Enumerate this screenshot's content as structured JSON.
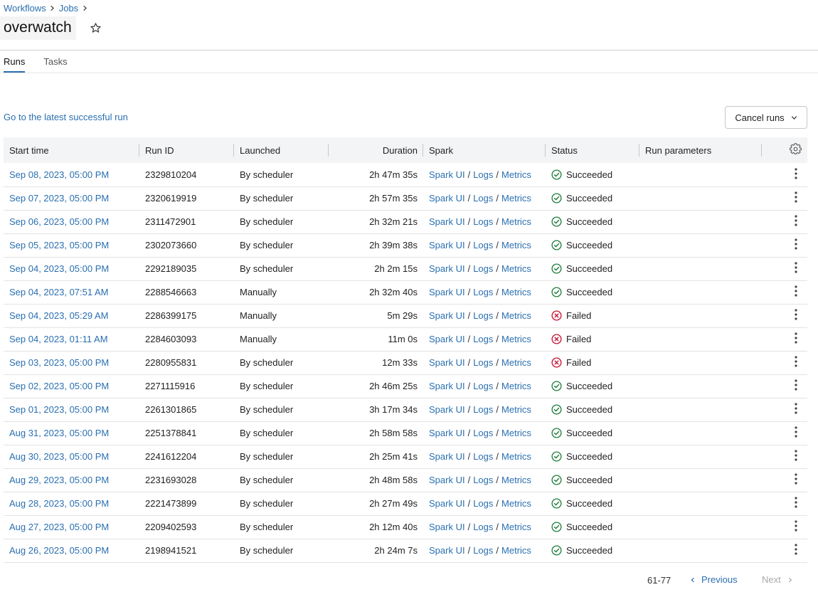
{
  "breadcrumb": [
    "Workflows",
    "Jobs"
  ],
  "job_title": "overwatch",
  "tabs": [
    {
      "label": "Runs",
      "active": true
    },
    {
      "label": "Tasks",
      "active": false
    }
  ],
  "latest_link": "Go to the latest successful run",
  "cancel_runs_label": "Cancel runs",
  "columns": {
    "start_time": "Start time",
    "run_id": "Run ID",
    "launched": "Launched",
    "duration": "Duration",
    "spark": "Spark",
    "status": "Status",
    "run_parameters": "Run parameters"
  },
  "spark_links": {
    "ui": "Spark UI",
    "sep": "/",
    "logs": "Logs",
    "metrics": "Metrics"
  },
  "runs": [
    {
      "start": "Sep 08, 2023, 05:00 PM",
      "id": "2329810204",
      "launched": "By scheduler",
      "duration": "2h 47m 35s",
      "status": "Succeeded"
    },
    {
      "start": "Sep 07, 2023, 05:00 PM",
      "id": "2320619919",
      "launched": "By scheduler",
      "duration": "2h 57m 35s",
      "status": "Succeeded"
    },
    {
      "start": "Sep 06, 2023, 05:00 PM",
      "id": "2311472901",
      "launched": "By scheduler",
      "duration": "2h 32m 21s",
      "status": "Succeeded"
    },
    {
      "start": "Sep 05, 2023, 05:00 PM",
      "id": "2302073660",
      "launched": "By scheduler",
      "duration": "2h 39m 38s",
      "status": "Succeeded"
    },
    {
      "start": "Sep 04, 2023, 05:00 PM",
      "id": "2292189035",
      "launched": "By scheduler",
      "duration": "2h 2m 15s",
      "status": "Succeeded"
    },
    {
      "start": "Sep 04, 2023, 07:51 AM",
      "id": "2288546663",
      "launched": "Manually",
      "duration": "2h 32m 40s",
      "status": "Succeeded"
    },
    {
      "start": "Sep 04, 2023, 05:29 AM",
      "id": "2286399175",
      "launched": "Manually",
      "duration": "5m 29s",
      "status": "Failed"
    },
    {
      "start": "Sep 04, 2023, 01:11 AM",
      "id": "2284603093",
      "launched": "Manually",
      "duration": "11m 0s",
      "status": "Failed"
    },
    {
      "start": "Sep 03, 2023, 05:00 PM",
      "id": "2280955831",
      "launched": "By scheduler",
      "duration": "12m 33s",
      "status": "Failed"
    },
    {
      "start": "Sep 02, 2023, 05:00 PM",
      "id": "2271115916",
      "launched": "By scheduler",
      "duration": "2h 46m 25s",
      "status": "Succeeded"
    },
    {
      "start": "Sep 01, 2023, 05:00 PM",
      "id": "2261301865",
      "launched": "By scheduler",
      "duration": "3h 17m 34s",
      "status": "Succeeded"
    },
    {
      "start": "Aug 31, 2023, 05:00 PM",
      "id": "2251378841",
      "launched": "By scheduler",
      "duration": "2h 58m 58s",
      "status": "Succeeded"
    },
    {
      "start": "Aug 30, 2023, 05:00 PM",
      "id": "2241612204",
      "launched": "By scheduler",
      "duration": "2h 25m 41s",
      "status": "Succeeded"
    },
    {
      "start": "Aug 29, 2023, 05:00 PM",
      "id": "2231693028",
      "launched": "By scheduler",
      "duration": "2h 48m 58s",
      "status": "Succeeded"
    },
    {
      "start": "Aug 28, 2023, 05:00 PM",
      "id": "2221473899",
      "launched": "By scheduler",
      "duration": "2h 27m 49s",
      "status": "Succeeded"
    },
    {
      "start": "Aug 27, 2023, 05:00 PM",
      "id": "2209402593",
      "launched": "By scheduler",
      "duration": "2h 12m 40s",
      "status": "Succeeded"
    },
    {
      "start": "Aug 26, 2023, 05:00 PM",
      "id": "2198941521",
      "launched": "By scheduler",
      "duration": "2h 24m 7s",
      "status": "Succeeded"
    }
  ],
  "pagination": {
    "range": "61-77",
    "previous": "Previous",
    "next": "Next"
  },
  "colors": {
    "link": "#2a6fb0",
    "success": "#1e7d3a",
    "failed": "#c8102e",
    "header_bg": "#f3f4f5"
  },
  "icons": {
    "breadcrumb_separator": "chevron-right-icon",
    "favorite": "star-icon",
    "dropdown": "chevron-down-icon",
    "settings": "gear-icon",
    "row_menu": "kebab-menu-icon",
    "succeeded": "check-circle-icon",
    "failed": "x-circle-icon",
    "previous": "chevron-left-icon",
    "next": "chevron-right-icon"
  }
}
